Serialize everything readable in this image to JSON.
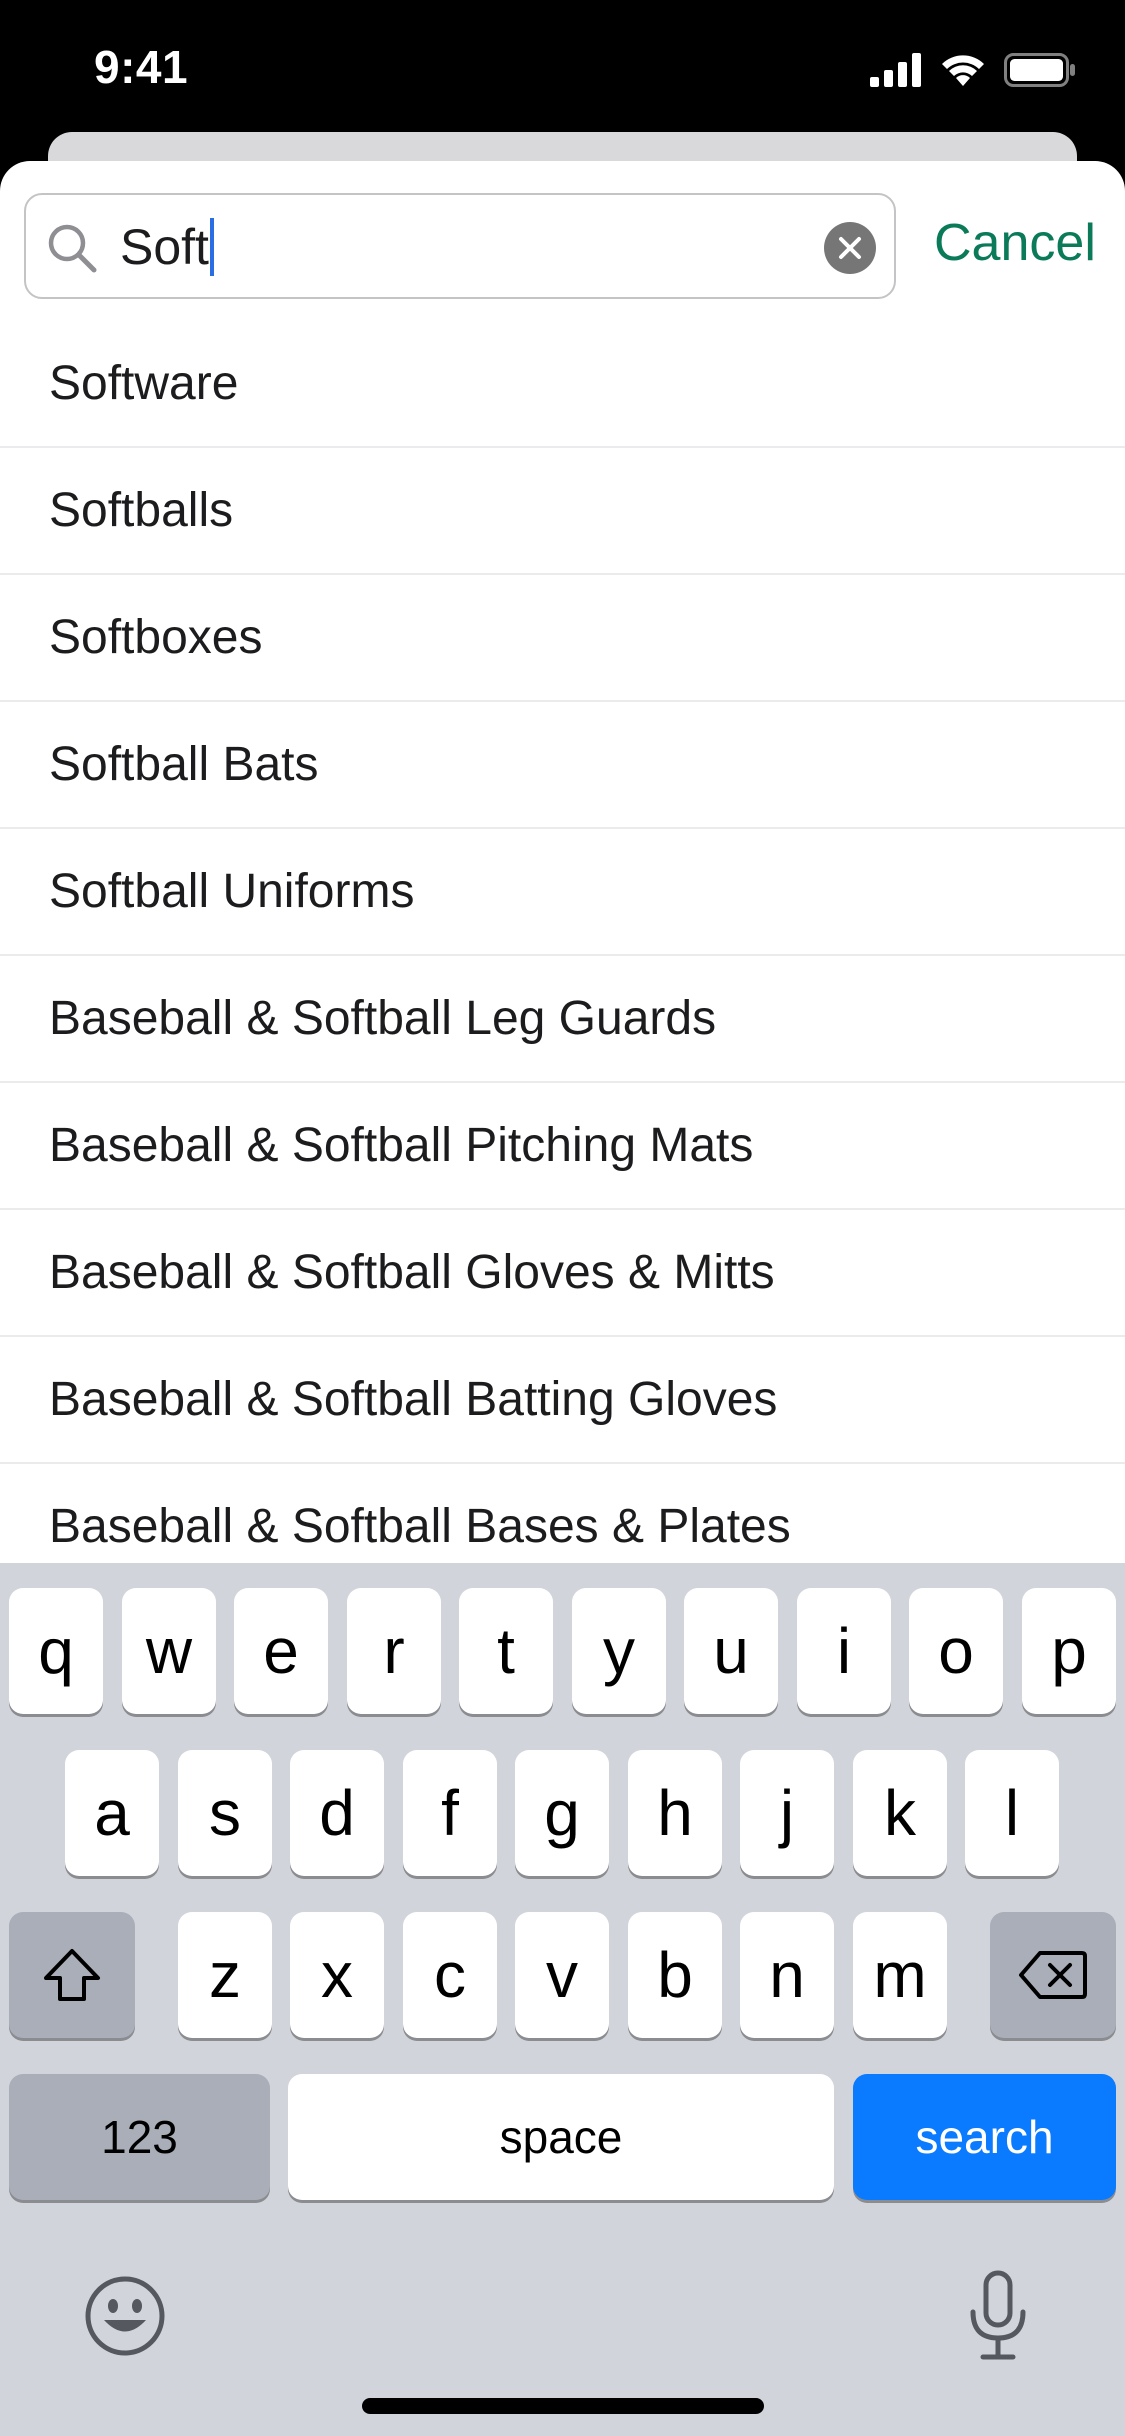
{
  "status_bar": {
    "time": "9:41",
    "icons": [
      "cellular-signal-icon",
      "wifi-icon",
      "battery-icon"
    ]
  },
  "search": {
    "value": "Soft",
    "cancel_label": "Cancel"
  },
  "colors": {
    "accent": "#0a7a58",
    "search_key": "#0a7aff",
    "caret": "#2b6de2"
  },
  "suggestions": [
    "Software",
    "Softballs",
    "Softboxes",
    "Softball Bats",
    "Softball Uniforms",
    "Baseball & Softball Leg Guards",
    "Baseball & Softball Pitching Mats",
    "Baseball & Softball Gloves & Mitts",
    "Baseball & Softball Batting Gloves",
    "Baseball & Softball Bases & Plates"
  ],
  "keyboard": {
    "row1": [
      "q",
      "w",
      "e",
      "r",
      "t",
      "y",
      "u",
      "i",
      "o",
      "p"
    ],
    "row2": [
      "a",
      "s",
      "d",
      "f",
      "g",
      "h",
      "j",
      "k",
      "l"
    ],
    "row3": [
      "z",
      "x",
      "c",
      "v",
      "b",
      "n",
      "m"
    ],
    "numbers_label": "123",
    "space_label": "space",
    "search_label": "search",
    "icons": [
      "shift-icon",
      "backspace-icon",
      "emoji-icon",
      "microphone-icon"
    ]
  }
}
